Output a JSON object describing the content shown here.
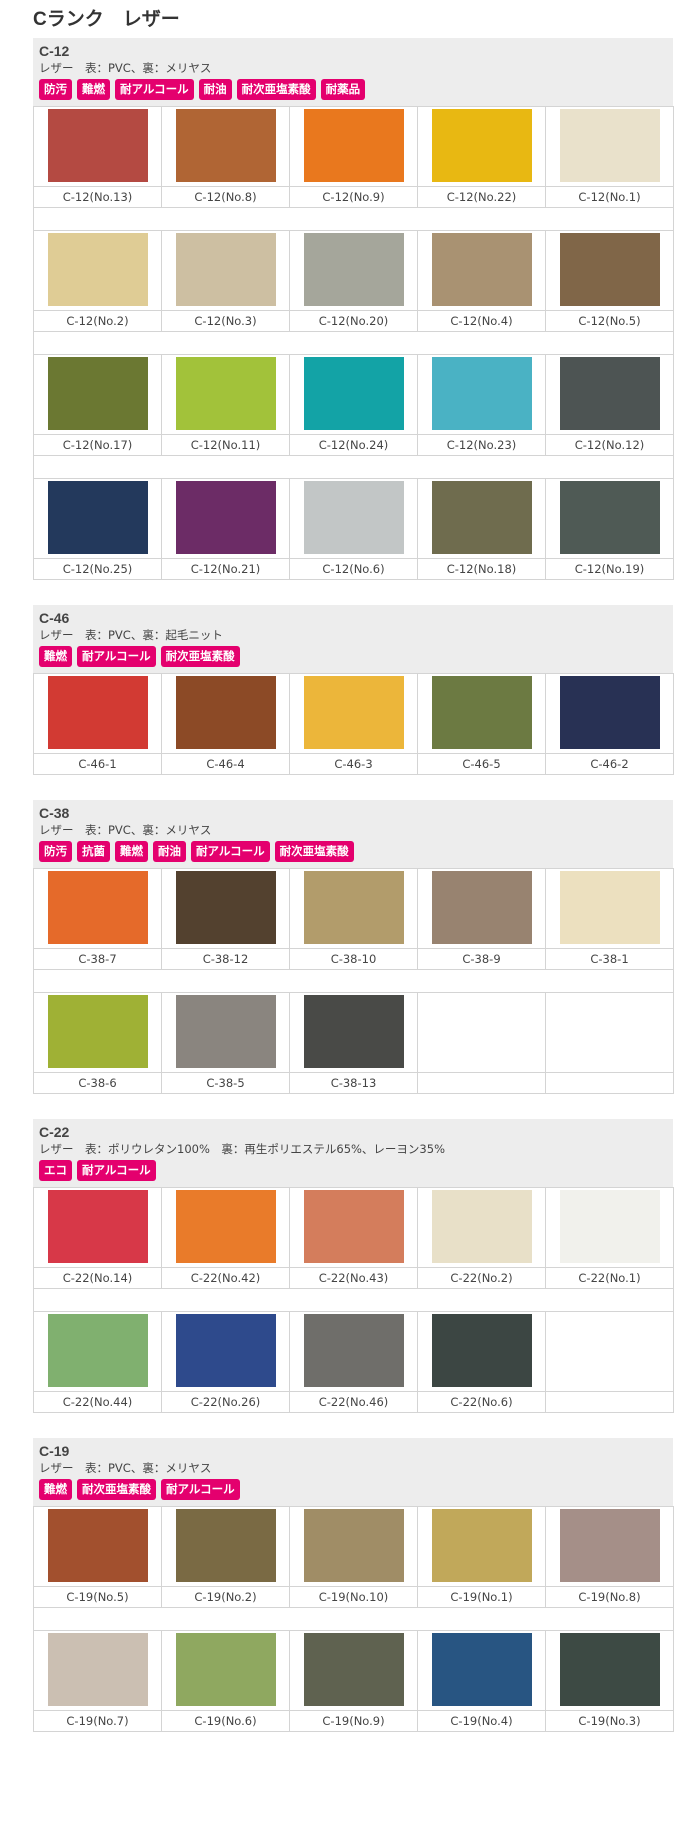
{
  "title": "Cランク　レザー",
  "sections": [
    {
      "code": "C-12",
      "desc": "レザー　表：PVC、裏：メリヤス",
      "tags": [
        "防汚",
        "難燃",
        "耐アルコール",
        "耐油",
        "耐次亜塩素酸",
        "耐薬品"
      ],
      "rows": [
        [
          {
            "name": "C-12(No.13)",
            "color": "#b44a42"
          },
          {
            "name": "C-12(No.8)",
            "color": "#b06534"
          },
          {
            "name": "C-12(No.9)",
            "color": "#e9781e"
          },
          {
            "name": "C-12(No.22)",
            "color": "#e8b812"
          },
          {
            "name": "C-12(No.1)",
            "color": "#e9e1cb"
          }
        ],
        [
          {
            "name": "C-12(No.2)",
            "color": "#dfcc95"
          },
          {
            "name": "C-12(No.3)",
            "color": "#cdbfa2"
          },
          {
            "name": "C-12(No.20)",
            "color": "#a5a69b"
          },
          {
            "name": "C-12(No.4)",
            "color": "#a99272"
          },
          {
            "name": "C-12(No.5)",
            "color": "#806648"
          }
        ],
        [
          {
            "name": "C-12(No.17)",
            "color": "#6b7832"
          },
          {
            "name": "C-12(No.11)",
            "color": "#a2c23a"
          },
          {
            "name": "C-12(No.24)",
            "color": "#13a3a6"
          },
          {
            "name": "C-12(No.23)",
            "color": "#4ab2c4"
          },
          {
            "name": "C-12(No.12)",
            "color": "#4d5453"
          }
        ],
        [
          {
            "name": "C-12(No.25)",
            "color": "#23395c"
          },
          {
            "name": "C-12(No.21)",
            "color": "#6c2c66"
          },
          {
            "name": "C-12(No.6)",
            "color": "#c2c6c6"
          },
          {
            "name": "C-12(No.18)",
            "color": "#6f6c4e"
          },
          {
            "name": "C-12(No.19)",
            "color": "#4f5a55"
          }
        ]
      ]
    },
    {
      "code": "C-46",
      "desc": "レザー　表：PVC、裏：起毛ニット",
      "tags": [
        "難燃",
        "耐アルコール",
        "耐次亜塩素酸"
      ],
      "rows": [
        [
          {
            "name": "C-46-1",
            "color": "#d23a33"
          },
          {
            "name": "C-46-4",
            "color": "#8c4a26"
          },
          {
            "name": "C-46-3",
            "color": "#ecb63a"
          },
          {
            "name": "C-46-5",
            "color": "#6c7a42"
          },
          {
            "name": "C-46-2",
            "color": "#283154"
          }
        ]
      ]
    },
    {
      "code": "C-38",
      "desc": "レザー　表：PVC、裏：メリヤス",
      "tags": [
        "防汚",
        "抗菌",
        "難燃",
        "耐油",
        "耐アルコール",
        "耐次亜塩素酸"
      ],
      "rows": [
        [
          {
            "name": "C-38-7",
            "color": "#e56a2a"
          },
          {
            "name": "C-38-12",
            "color": "#53412f"
          },
          {
            "name": "C-38-10",
            "color": "#b29c6b"
          },
          {
            "name": "C-38-9",
            "color": "#988370"
          },
          {
            "name": "C-38-1",
            "color": "#ece0bf"
          }
        ],
        [
          {
            "name": "C-38-6",
            "color": "#9fb135"
          },
          {
            "name": "C-38-5",
            "color": "#8a857f"
          },
          {
            "name": "C-38-13",
            "color": "#494a47"
          }
        ]
      ]
    },
    {
      "code": "C-22",
      "desc": "レザー　表：ポリウレタン100%　裏：再生ポリエステル65%、レーヨン35%",
      "tags": [
        "エコ",
        "耐アルコール"
      ],
      "rows": [
        [
          {
            "name": "C-22(No.14)",
            "color": "#d73848"
          },
          {
            "name": "C-22(No.42)",
            "color": "#e97b2a"
          },
          {
            "name": "C-22(No.43)",
            "color": "#d47d5c"
          },
          {
            "name": "C-22(No.2)",
            "color": "#e8e0c8"
          },
          {
            "name": "C-22(No.1)",
            "color": "#f1f1ec"
          }
        ],
        [
          {
            "name": "C-22(No.44)",
            "color": "#80b06f"
          },
          {
            "name": "C-22(No.26)",
            "color": "#2e4a8c"
          },
          {
            "name": "C-22(No.46)",
            "color": "#6f6e6a"
          },
          {
            "name": "C-22(No.6)",
            "color": "#3c4643"
          }
        ]
      ]
    },
    {
      "code": "C-19",
      "desc": "レザー　表：PVC、裏：メリヤス",
      "tags": [
        "難燃",
        "耐次亜塩素酸",
        "耐アルコール"
      ],
      "rows": [
        [
          {
            "name": "C-19(No.5)",
            "color": "#a2502e"
          },
          {
            "name": "C-19(No.2)",
            "color": "#7a6a44"
          },
          {
            "name": "C-19(No.10)",
            "color": "#a08d66"
          },
          {
            "name": "C-19(No.1)",
            "color": "#c1a85a"
          },
          {
            "name": "C-19(No.8)",
            "color": "#a58f88"
          }
        ],
        [
          {
            "name": "C-19(No.7)",
            "color": "#cbbfb2"
          },
          {
            "name": "C-19(No.6)",
            "color": "#8fa860"
          },
          {
            "name": "C-19(No.9)",
            "color": "#5f6250"
          },
          {
            "name": "C-19(No.4)",
            "color": "#285582"
          },
          {
            "name": "C-19(No.3)",
            "color": "#3d4a44"
          }
        ]
      ]
    }
  ]
}
